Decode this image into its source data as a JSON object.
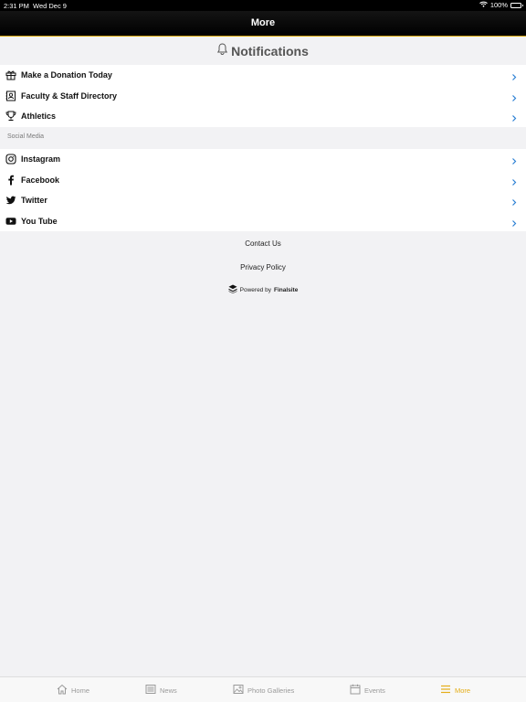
{
  "status_bar": {
    "time": "2:31 PM",
    "date": "Wed Dec 9",
    "battery": "100%"
  },
  "header": {
    "title": "More"
  },
  "notifications": {
    "label": "Notifications"
  },
  "menu": [
    {
      "label": "Make a Donation Today",
      "icon": "gift-icon"
    },
    {
      "label": "Faculty & Staff Directory",
      "icon": "contacts-icon"
    },
    {
      "label": "Athletics",
      "icon": "trophy-icon"
    }
  ],
  "social": {
    "heading": "Social Media",
    "items": [
      {
        "label": "Instagram",
        "icon": "instagram-icon"
      },
      {
        "label": "Facebook",
        "icon": "facebook-icon"
      },
      {
        "label": "Twitter",
        "icon": "twitter-icon"
      },
      {
        "label": "You Tube",
        "icon": "youtube-icon"
      }
    ]
  },
  "footer": {
    "contact": "Contact Us",
    "privacy": "Privacy Policy",
    "powered_prefix": "Powered by",
    "powered_brand": "Finalsite"
  },
  "tabs": [
    {
      "label": "Home",
      "icon": "home-icon",
      "active": false
    },
    {
      "label": "News",
      "icon": "news-icon",
      "active": false
    },
    {
      "label": "Photo Galleries",
      "icon": "photo-icon",
      "active": false
    },
    {
      "label": "Events",
      "icon": "calendar-icon",
      "active": false
    },
    {
      "label": "More",
      "icon": "menu-icon",
      "active": true
    }
  ],
  "colors": {
    "accent": "#e4ad17",
    "chevron": "#2a7fd4",
    "header_bg": "#000000"
  }
}
